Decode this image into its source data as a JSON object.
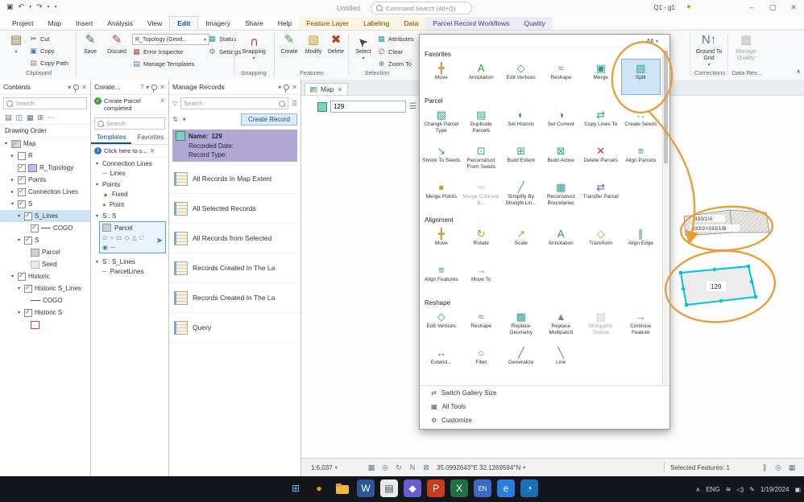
{
  "colors": {
    "accent_blue": "#2b79c2",
    "annotation_orange": "#e89b2e",
    "parcel_cyan": "#00c5d4",
    "record_header": "#b1a9d3",
    "selection_blue": "#cfe5f7"
  },
  "titlebar": {
    "title": "Untitled",
    "search_placeholder": "Command Search (Alt+Q)",
    "user": "Q1 - g1"
  },
  "tabs": {
    "active": "Edit",
    "items": [
      {
        "label": "Project",
        "group": "core"
      },
      {
        "label": "Map",
        "group": "core"
      },
      {
        "label": "Insert",
        "group": "core"
      },
      {
        "label": "Analysis",
        "group": "core"
      },
      {
        "label": "View",
        "group": "core"
      },
      {
        "label": "Edit",
        "group": "core"
      },
      {
        "label": "Imagery",
        "group": "core"
      },
      {
        "label": "Share",
        "group": "core"
      },
      {
        "label": "Help",
        "group": "core"
      },
      {
        "label": "Feature Layer",
        "group": "layer"
      },
      {
        "label": "Labeling",
        "group": "layer"
      },
      {
        "label": "Data",
        "group": "layer"
      },
      {
        "label": "Parcel Record Workflows",
        "group": "parcel"
      },
      {
        "label": "Quality",
        "group": "parcel"
      }
    ]
  },
  "ribbon": {
    "clipboard": {
      "paste": "Paste",
      "cut": "Cut",
      "copy": "Copy",
      "copy_path": "Copy Path",
      "label": "Clipboard"
    },
    "manage": {
      "save": "Save",
      "discard": "Discard",
      "topology": "R_Topology (Geod..",
      "status": "Status",
      "error_inspector": "Error Inspector",
      "settings": "Settings",
      "manage_templates": "Manage Templates"
    },
    "snapping": {
      "button": "Snapping",
      "label": "Snapping"
    },
    "features": {
      "create": "Create",
      "modify": "Modify",
      "delete": "Delete",
      "label": "Features"
    },
    "selection": {
      "select": "Select",
      "attributes": "Attributes",
      "clear": "Clear",
      "zoom_to": "Zoom To",
      "label": "Selection"
    },
    "right": {
      "ground_to_grid": "Ground To Grid",
      "manage_quality": "Manage Quality",
      "corrections_label": "Corrections",
      "data_review_label": "Data Rev..."
    }
  },
  "contents": {
    "title": "Contents",
    "search_placeholder": "Search",
    "section": "Drawing Order",
    "toolbar_icons": [
      {
        "name": "list-by-drawing-order-icon",
        "glyph": "▤"
      },
      {
        "name": "list-by-source-icon",
        "glyph": "◫"
      },
      {
        "name": "list-by-selection-icon",
        "glyph": "▦"
      },
      {
        "name": "list-by-editing-icon",
        "glyph": "⊞"
      },
      {
        "name": "more-options-icon",
        "glyph": "⋯"
      }
    ],
    "tree": [
      {
        "label": "Map",
        "level": 0,
        "exp": "open",
        "swatch": "map"
      },
      {
        "label": "R",
        "level": 1,
        "exp": "closed",
        "cb": false
      },
      {
        "label": "R_Topology",
        "level": 1,
        "cb": true,
        "swatch": "topology"
      },
      {
        "label": "Points",
        "level": 1,
        "exp": "closed",
        "cb": true
      },
      {
        "label": "Connection Lines",
        "level": 1,
        "exp": "closed",
        "cb": true
      },
      {
        "label": "S",
        "level": 1,
        "exp": "open",
        "cb": true
      },
      {
        "label": "S_Lines",
        "level": 2,
        "exp": "open",
        "cb": true,
        "selected": true
      },
      {
        "label": "COGO",
        "level": 3,
        "cb": true,
        "swatch": "line"
      },
      {
        "label": "S",
        "level": 2,
        "exp": "open",
        "cb": true
      },
      {
        "label": "Parcel",
        "level": 3,
        "swatch": "gray"
      },
      {
        "label": "Seed",
        "level": 3,
        "swatch": "lightgray"
      },
      {
        "label": "Historic",
        "level": 1,
        "exp": "open",
        "cb": true
      },
      {
        "label": "Historic S_Lines",
        "level": 2,
        "exp": "open",
        "cb": true
      },
      {
        "label": "COGO",
        "level": 3,
        "swatch": "line"
      },
      {
        "label": "Historic S",
        "level": 2,
        "exp": "open",
        "cb": true
      },
      {
        "label": "",
        "level": 3,
        "swatch": "red-outline"
      }
    ]
  },
  "create_features": {
    "title": "Create...",
    "notification": "Create Parcel completed",
    "search_placeholder": "Search",
    "tabs": [
      "Templates",
      "Favorites"
    ],
    "active_tab": "Templates",
    "hint": "Click here to s...",
    "groups": [
      {
        "label": "Connection Lines",
        "items": [
          {
            "label": "Lines",
            "icon": "line"
          }
        ]
      },
      {
        "label": "Points",
        "items": [
          {
            "label": "Fixed",
            "icon": "fixed"
          },
          {
            "label": "Point",
            "icon": "point"
          }
        ]
      },
      {
        "label": "S : S",
        "items": [
          {
            "label": "Parcel",
            "icon": "polygon",
            "selected": true,
            "tools": [
              "▱",
              "○",
              "▭",
              "◇",
              "△",
              "□",
              "◉",
              "─"
            ]
          }
        ]
      },
      {
        "label": "S : S_Lines",
        "items": [
          {
            "label": "ParcelLines",
            "icon": "line"
          }
        ]
      }
    ]
  },
  "manage_records": {
    "title": "Manage Records",
    "search_placeholder": "Search",
    "create_record": "Create Record",
    "active_record": {
      "name_label": "Name:",
      "name": "129",
      "date_label": "Recorded Date:",
      "type_label": "Record Type:"
    },
    "records": [
      "All Records In Map Extent",
      "All Selected Records",
      "All Records from Selected",
      "Records Created In The La",
      "Records Created In The La",
      "Query"
    ]
  },
  "map": {
    "tab": "Map",
    "field_value": "129",
    "parcel_labels": {
      "a": "333/1/A",
      "b": "333/2+333/1/B",
      "c": "129"
    }
  },
  "gallery": {
    "filter_label": "All",
    "sections": [
      {
        "title": "Favorites",
        "items": [
          {
            "label": "Move",
            "icon": "move"
          },
          {
            "label": "Annotation",
            "icon": "annotation"
          },
          {
            "label": "Edit Vertices",
            "icon": "edit-vertices"
          },
          {
            "label": "Reshape",
            "icon": "reshape"
          },
          {
            "label": "Merge",
            "icon": "merge"
          },
          {
            "label": "Split",
            "icon": "split",
            "selected": true
          }
        ]
      },
      {
        "title": "Parcel",
        "items": [
          {
            "label": "Change Parcel Type",
            "icon": "change-parcel-type"
          },
          {
            "label": "Duplicate Parcels",
            "icon": "duplicate-parcels"
          },
          {
            "label": "Set Historic",
            "icon": "set-historic"
          },
          {
            "label": "Set Current",
            "icon": "set-current"
          },
          {
            "label": "Copy Lines To",
            "icon": "copy-lines-to"
          },
          {
            "label": "Create Seeds",
            "icon": "create-seeds"
          },
          {
            "label": "Shrink To Seeds",
            "icon": "shrink-to-seeds"
          },
          {
            "label": "Reconstruct From Seeds",
            "icon": "reconstruct-from-seeds"
          },
          {
            "label": "Build Extent",
            "icon": "build-extent"
          },
          {
            "label": "Build Active",
            "icon": "build-active"
          },
          {
            "label": "Delete Parcels",
            "icon": "delete-parcels"
          },
          {
            "label": "Align Parcels",
            "icon": "align-parcels"
          },
          {
            "label": "Merge Points",
            "icon": "merge-points"
          },
          {
            "label": "Merge Collinear B...",
            "icon": "merge-collinear",
            "disabled": true
          },
          {
            "label": "Simplify By Straight Lin...",
            "icon": "simplify"
          },
          {
            "label": "Reconstruct Boundaries",
            "icon": "reconstruct-boundaries"
          },
          {
            "label": "Transfer Parcel",
            "icon": "transfer-parcel"
          }
        ]
      },
      {
        "title": "Alignment",
        "items": [
          {
            "label": "Move",
            "icon": "move"
          },
          {
            "label": "Rotate",
            "icon": "rotate"
          },
          {
            "label": "Scale",
            "icon": "scale"
          },
          {
            "label": "Annotation",
            "icon": "annotation"
          },
          {
            "label": "Transform",
            "icon": "transform"
          },
          {
            "label": "Align Edge",
            "icon": "align-edge"
          },
          {
            "label": "Align Features",
            "icon": "align-features"
          },
          {
            "label": "Move To",
            "icon": "move-to"
          }
        ]
      },
      {
        "title": "Reshape",
        "items": [
          {
            "label": "Edit Vertices",
            "icon": "edit-vertices"
          },
          {
            "label": "Reshape",
            "icon": "reshape"
          },
          {
            "label": "Replace Geometry",
            "icon": "replace-geometry"
          },
          {
            "label": "Replace Multipatch",
            "icon": "replace-multipatch"
          },
          {
            "label": "Multipatch Texture",
            "icon": "multipatch-texture",
            "disabled": true
          },
          {
            "label": "Continue Feature",
            "icon": "continue-feature"
          },
          {
            "label": "Extend...",
            "icon": "extend"
          },
          {
            "label": "Fillet",
            "icon": "fillet"
          },
          {
            "label": "Generalize",
            "icon": "generalize"
          },
          {
            "label": "Line",
            "icon": "line-tool"
          }
        ]
      }
    ],
    "footer": [
      {
        "label": "Switch Gallery Size",
        "icon": "switch"
      },
      {
        "label": "All Tools",
        "icon": "tools"
      },
      {
        "label": "Customize",
        "icon": "customize"
      }
    ]
  },
  "statusbar": {
    "scale": "1:6,037",
    "coords": "35.0992643°E 32.1269594°N",
    "selected": "Selected Features: 1",
    "left_icons": [
      {
        "name": "layout-grid-icon",
        "glyph": "▦"
      },
      {
        "name": "globe-icon",
        "glyph": "◎"
      },
      {
        "name": "refresh-icon",
        "glyph": "↻"
      },
      {
        "name": "north-icon",
        "glyph": "N"
      },
      {
        "name": "lock-icon",
        "glyph": "⊠"
      }
    ],
    "right_icons": [
      {
        "name": "pause-drawing-icon",
        "glyph": "∥"
      },
      {
        "name": "globe-view-icon",
        "glyph": "◎"
      },
      {
        "name": "basemap-icon",
        "glyph": "▦"
      }
    ]
  },
  "taskbar": {
    "lang": "ENG",
    "date": "1/19/2024",
    "icons": [
      {
        "name": "start-button",
        "glyph": "⊞",
        "color": "#6cb8f6",
        "bg": "none"
      },
      {
        "name": "firefox-icon",
        "glyph": "●",
        "color": "#ff9500",
        "bg": "none"
      },
      {
        "name": "folder-icon",
        "glyph": "",
        "color": "#f0b93c",
        "bg": "folder"
      },
      {
        "name": "word-icon",
        "glyph": "W",
        "color": "#ffffff",
        "bg": "#2b5797"
      },
      {
        "name": "notes-icon",
        "glyph": "▤",
        "color": "#444444",
        "bg": "#e8eaed"
      },
      {
        "name": "store-icon",
        "glyph": "◆",
        "color": "#ffffff",
        "bg": "#6b5bd2"
      },
      {
        "name": "powerpoint-icon",
        "glyph": "P",
        "color": "#ffffff",
        "bg": "#c43e1c"
      },
      {
        "name": "excel-icon",
        "glyph": "X",
        "color": "#ffffff",
        "bg": "#1e7145"
      },
      {
        "name": "language-en-badge",
        "glyph": "EN",
        "color": "#ffffff",
        "bg": "#3a6bc8"
      },
      {
        "name": "edge-icon",
        "glyph": "e",
        "color": "#ffffff",
        "bg": "#2a7de1"
      },
      {
        "name": "arcgis-icon",
        "glyph": "◔",
        "color": "#ffffff",
        "bg": "#1a6fb5"
      }
    ]
  }
}
